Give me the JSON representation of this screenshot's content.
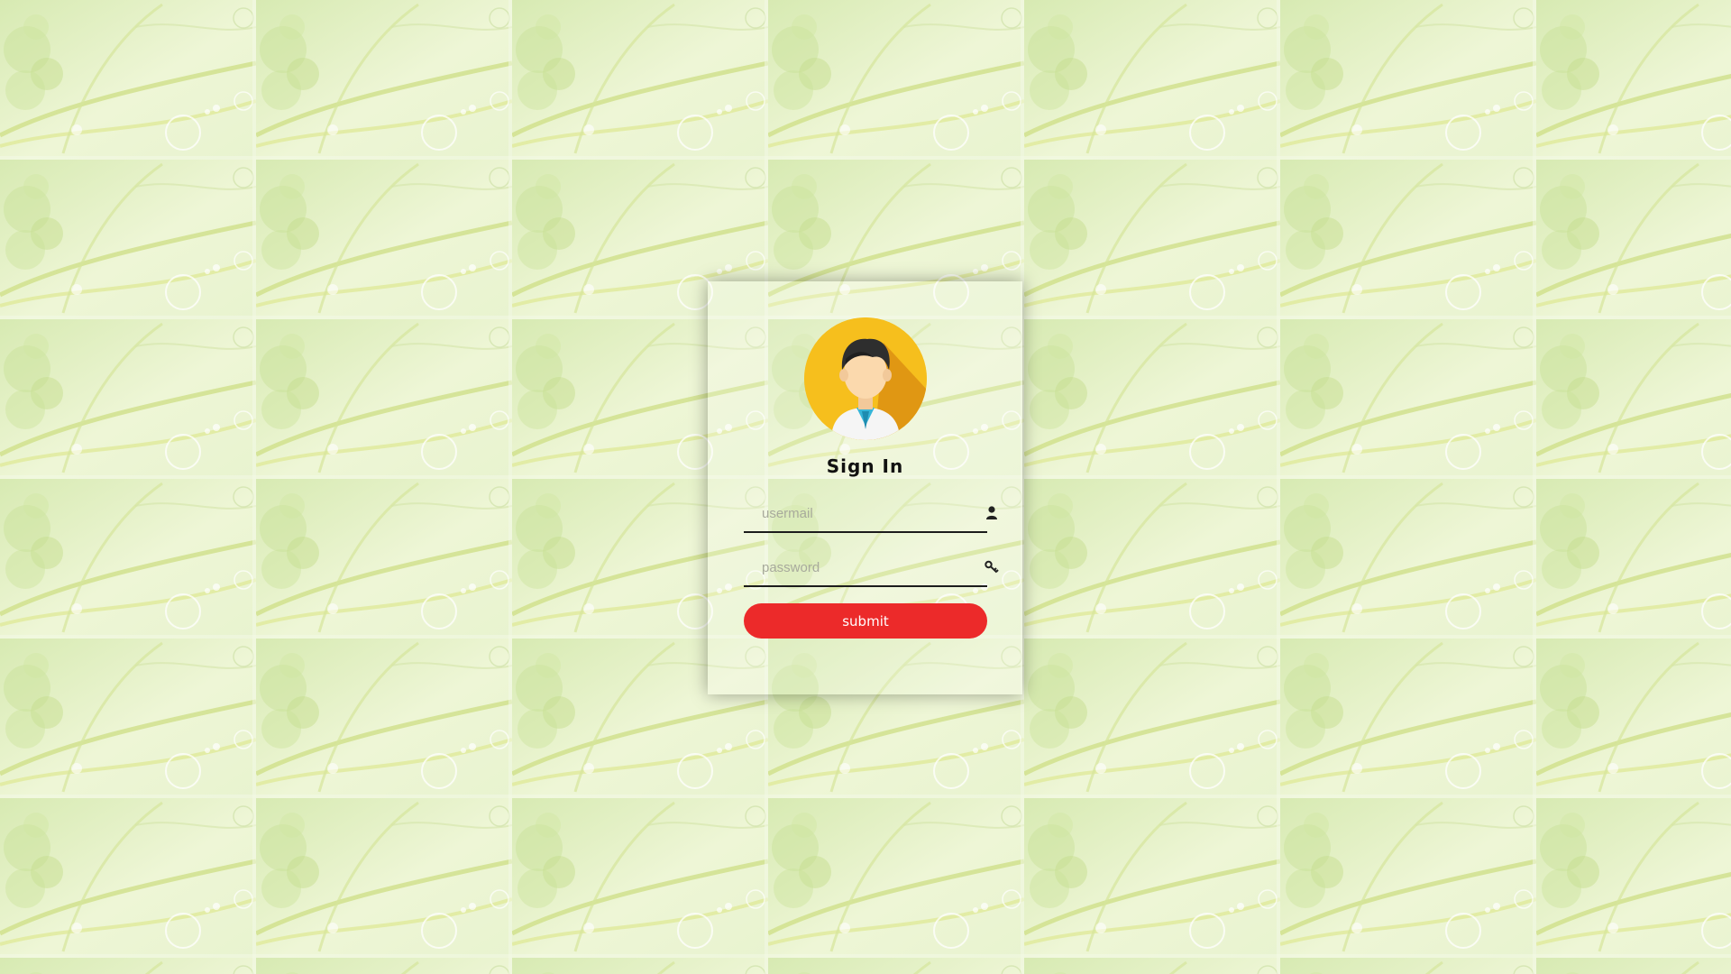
{
  "colors": {
    "background": "#e3f0c4",
    "accent": "#ec2a2a",
    "avatar_bg": "#f6bf1d"
  },
  "form": {
    "title": "Sign In",
    "username": {
      "placeholder": "usermail",
      "value": "",
      "icon": "user-icon"
    },
    "password": {
      "placeholder": "password",
      "value": "",
      "icon": "key-icon"
    },
    "submit_label": "submit"
  },
  "avatar": {
    "icon": "doctor-avatar-icon"
  }
}
